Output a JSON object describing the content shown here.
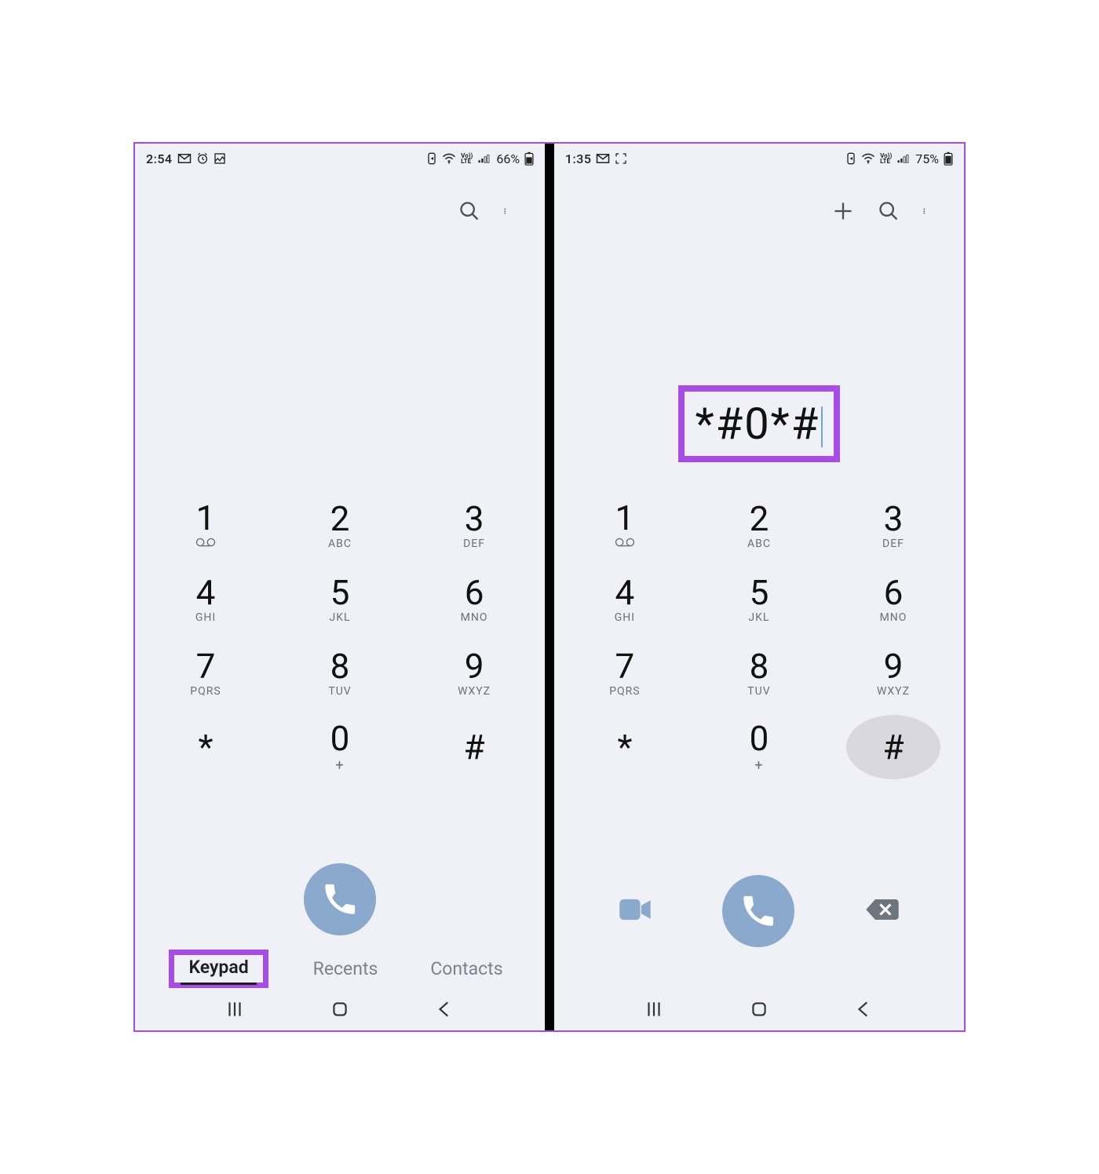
{
  "left": {
    "status": {
      "time": "2:54",
      "battery": "66%"
    },
    "display": "",
    "tabs": {
      "keypad": "Keypad",
      "recents": "Recents",
      "contacts": "Contacts",
      "active": "keypad"
    }
  },
  "right": {
    "status": {
      "time": "1:35",
      "battery": "75%"
    },
    "display": "*#0*#",
    "pressed_key": "#"
  },
  "keypad": [
    [
      {
        "d": "1",
        "s": "vm"
      },
      {
        "d": "2",
        "s": "ABC"
      },
      {
        "d": "3",
        "s": "DEF"
      }
    ],
    [
      {
        "d": "4",
        "s": "GHI"
      },
      {
        "d": "5",
        "s": "JKL"
      },
      {
        "d": "6",
        "s": "MNO"
      }
    ],
    [
      {
        "d": "7",
        "s": "PQRS"
      },
      {
        "d": "8",
        "s": "TUV"
      },
      {
        "d": "9",
        "s": "WXYZ"
      }
    ],
    [
      {
        "d": "*",
        "s": ""
      },
      {
        "d": "0",
        "s": "+"
      },
      {
        "d": "#",
        "s": ""
      }
    ]
  ],
  "highlights": {
    "left_tab_keypad": true,
    "right_display": true
  }
}
